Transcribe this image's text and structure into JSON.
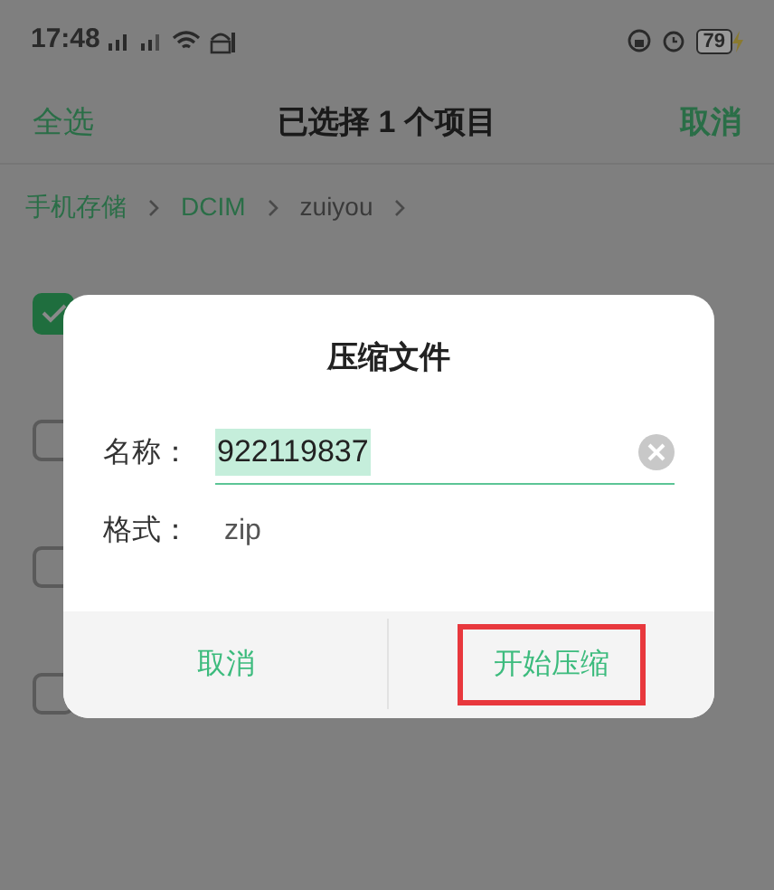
{
  "status_bar": {
    "time": "17:48",
    "battery": "79"
  },
  "header": {
    "left_action": "全选",
    "title": "已选择 1 个项目",
    "right_action": "取消"
  },
  "breadcrumb": [
    {
      "label": "手机存储",
      "kind": "link"
    },
    {
      "label": "DCIM",
      "kind": "link"
    },
    {
      "label": "zuiyou",
      "kind": "current"
    }
  ],
  "file_rows": [
    {
      "checked": true
    },
    {
      "checked": false
    },
    {
      "checked": false
    },
    {
      "checked": false
    }
  ],
  "dialog": {
    "title": "压缩文件",
    "fields": [
      {
        "label": "名称：",
        "value": "922119837",
        "kind": "input",
        "text_selected": true
      },
      {
        "label": "格式：",
        "value": "zip",
        "kind": "static"
      }
    ],
    "buttons": [
      {
        "label": "取消",
        "highlighted": false
      },
      {
        "label": "开始压缩",
        "highlighted": true
      }
    ]
  }
}
